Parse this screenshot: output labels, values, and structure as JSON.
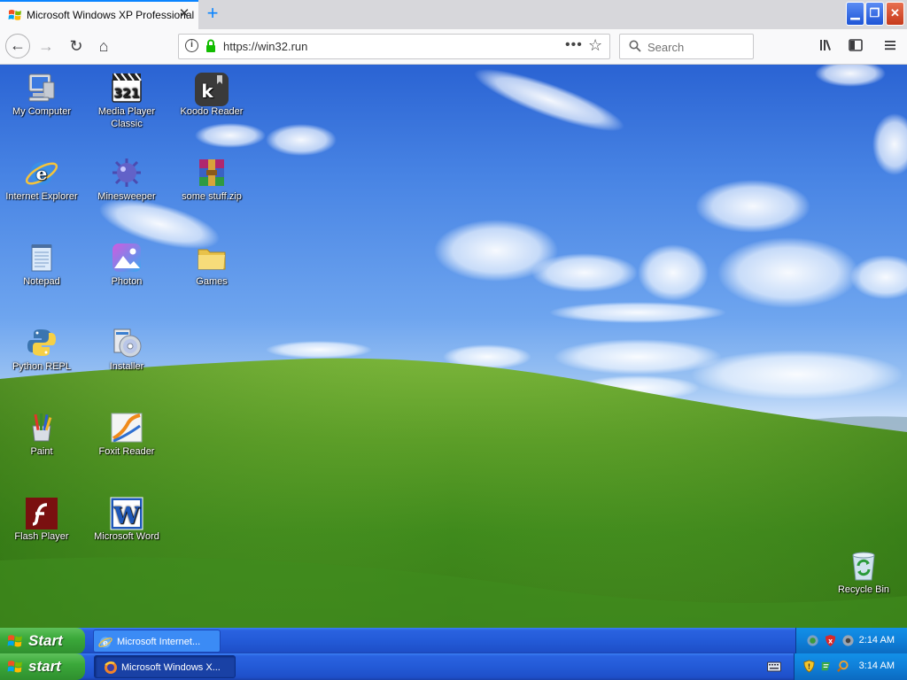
{
  "browser": {
    "tab_title": "Microsoft Windows XP Professional",
    "new_tab_label": "+",
    "url": "https://win32.run",
    "search_placeholder": "Search"
  },
  "desktop": {
    "icons": [
      {
        "label": "My Computer",
        "icon": "my-computer-icon"
      },
      {
        "label": "Media Player Classic",
        "icon": "media-player-classic-icon"
      },
      {
        "label": "Koodo Reader",
        "icon": "koodo-reader-icon"
      },
      {
        "label": "Internet Explorer",
        "icon": "internet-explorer-icon"
      },
      {
        "label": "Minesweeper",
        "icon": "minesweeper-icon"
      },
      {
        "label": "some stuff.zip",
        "icon": "winrar-archive-icon"
      },
      {
        "label": "Notepad",
        "icon": "notepad-icon"
      },
      {
        "label": "Photon",
        "icon": "photon-icon"
      },
      {
        "label": "Games",
        "icon": "folder-icon"
      },
      {
        "label": "Python REPL",
        "icon": "python-icon"
      },
      {
        "label": "Installer",
        "icon": "installer-icon"
      },
      {
        "label": "Paint",
        "icon": "paint-icon"
      },
      {
        "label": "Foxit Reader",
        "icon": "foxit-reader-icon"
      },
      {
        "label": "Flash Player",
        "icon": "flash-player-icon"
      },
      {
        "label": "Microsoft Word",
        "icon": "word-icon"
      },
      {
        "label": "Recycle Bin",
        "icon": "recycle-bin-icon"
      }
    ]
  },
  "taskbar_inner": {
    "start_label": "Start",
    "task_label": "Microsoft Internet...",
    "clock": "2:14 AM"
  },
  "taskbar_outer": {
    "start_label": "start",
    "task_label": "Microsoft Windows X...",
    "clock": "3:14 AM"
  },
  "colors": {
    "taskbar_blue": "#235ad7",
    "start_green": "#3ba93a",
    "tray_blue": "#0f7fd8",
    "firefox_accent": "#0a84ff"
  }
}
